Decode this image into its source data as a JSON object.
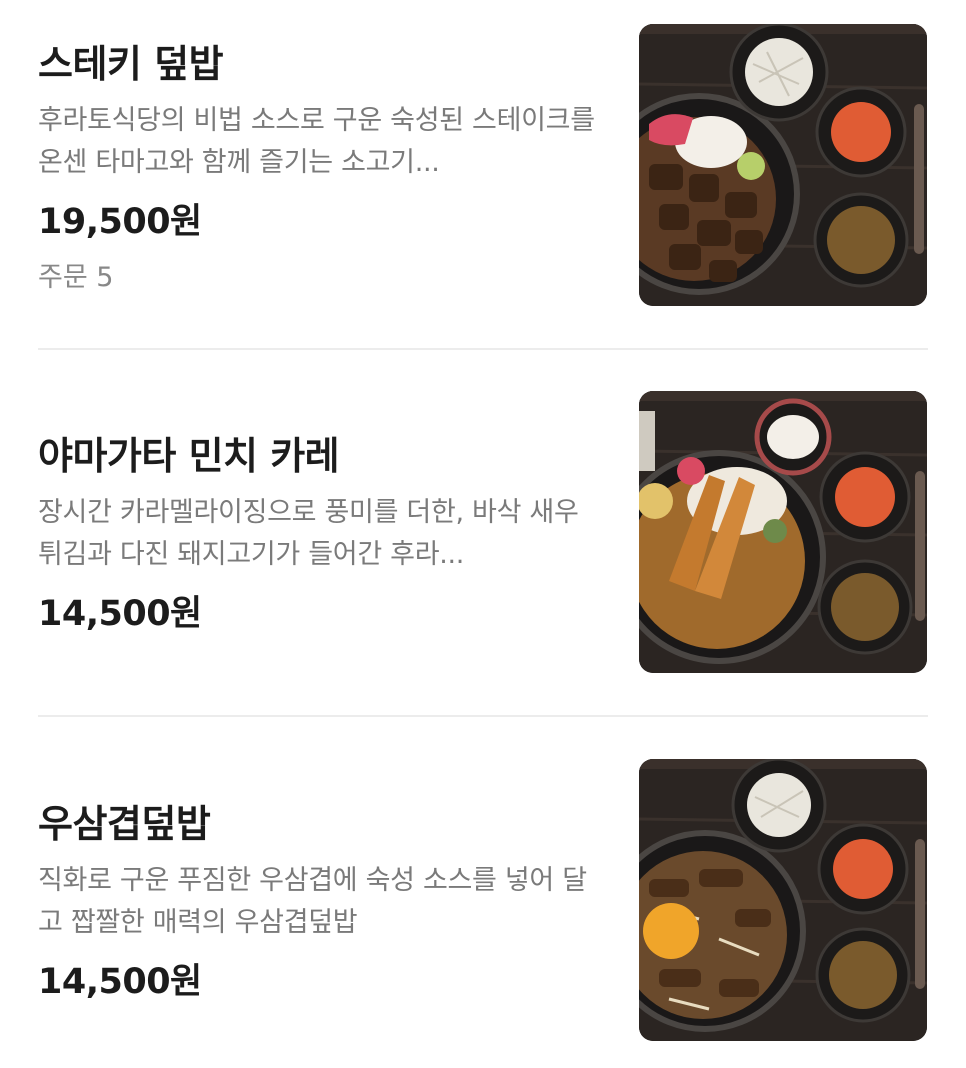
{
  "menu": {
    "items": [
      {
        "name": "스테키 덮밥",
        "description": "후라토식당의 비법 소스로 구운 숙성된 스테이크를 온센 타마고와 함께 즐기는 소고기...",
        "price": "19,500원",
        "orders": "주문 5",
        "image_icon": "steak-bowl-photo"
      },
      {
        "name": "야마가타 민치 카레",
        "description": "장시간 카라멜라이징으로 풍미를 더한, 바삭 새우튀김과 다진 돼지고기가 들어간 후라...",
        "price": "14,500원",
        "image_icon": "curry-bowl-photo"
      },
      {
        "name": "우삼겹덮밥",
        "description": "직화로 구운 푸짐한 우삼겹에 숙성 소스를 넣어 달고 짭짤한 매력의 우삼겹덮밥",
        "price": "14,500원",
        "image_icon": "beef-brisket-bowl-photo"
      }
    ]
  }
}
